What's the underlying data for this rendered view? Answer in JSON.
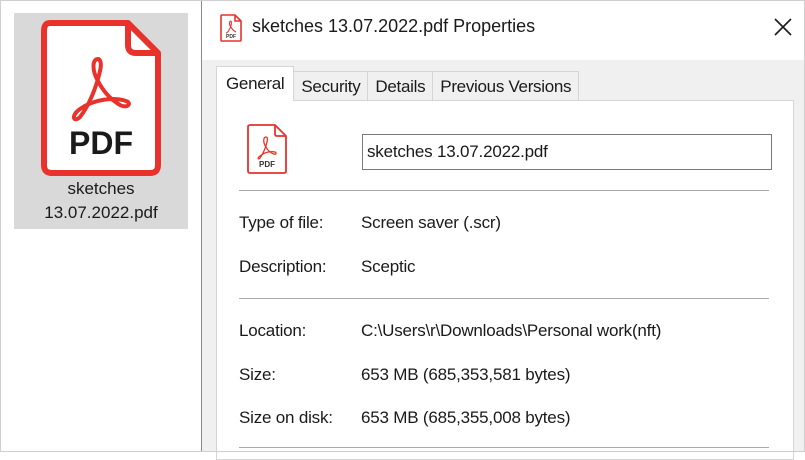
{
  "file_icon": {
    "icon": "pdf-file-icon",
    "badge_text": "PDF",
    "label_line1": "sketches",
    "label_line2": "13.07.2022.pdf"
  },
  "dialog": {
    "title": "sketches 13.07.2022.pdf Properties",
    "close_icon": "close-icon",
    "tabs": [
      {
        "label": "General",
        "active": true
      },
      {
        "label": "Security",
        "active": false
      },
      {
        "label": "Details",
        "active": false
      },
      {
        "label": "Previous Versions",
        "active": false
      }
    ],
    "general": {
      "file_name": "sketches 13.07.2022.pdf",
      "rows": [
        {
          "label": "Type of file:",
          "value": "Screen saver (.scr)"
        },
        {
          "label": "Description:",
          "value": "Sceptic"
        },
        {
          "label": "Location:",
          "value": "C:\\Users\\r\\Downloads\\Personal work(nft)"
        },
        {
          "label": "Size:",
          "value": "653 MB (685,353,581 bytes)"
        },
        {
          "label": "Size on disk:",
          "value": "653 MB (685,355,008 bytes)"
        }
      ]
    }
  },
  "colors": {
    "pdf_red": "#e8322b",
    "selection_bg": "#d9d9d9",
    "dialog_bg": "#f0f0f0"
  }
}
